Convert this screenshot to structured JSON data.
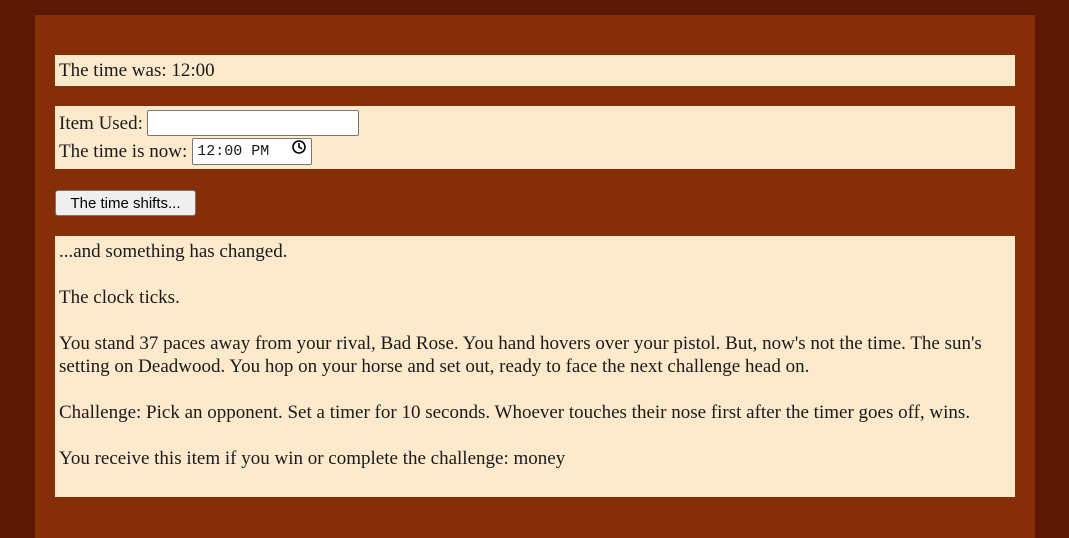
{
  "time_was": {
    "label": "The time was: ",
    "value": "12:00"
  },
  "controls": {
    "item_label": "Item Used:",
    "item_value": "",
    "time_label": "The time is now:",
    "time_value": "12:00 PM",
    "time_icon": "clock-icon"
  },
  "shift_button": {
    "label": "The time shifts..."
  },
  "story": {
    "line1": "...and something has changed.",
    "line2": "The clock ticks.",
    "paragraph": "You stand 37 paces away from your rival, Bad Rose. You hand hovers over your pistol. But, now's not the time. The sun's setting on Deadwood. You hop on your horse and set out, ready to face the next challenge head on.",
    "challenge": "Challenge: Pick an opponent. Set a timer for 10 seconds. Whoever touches their nose first after the timer goes off, wins.",
    "reward": "You receive this item if you win or complete the challenge: money"
  },
  "colors": {
    "outer_background": "#5a1805",
    "frame_background": "#862e07",
    "panel_background": "#fde9cb"
  }
}
